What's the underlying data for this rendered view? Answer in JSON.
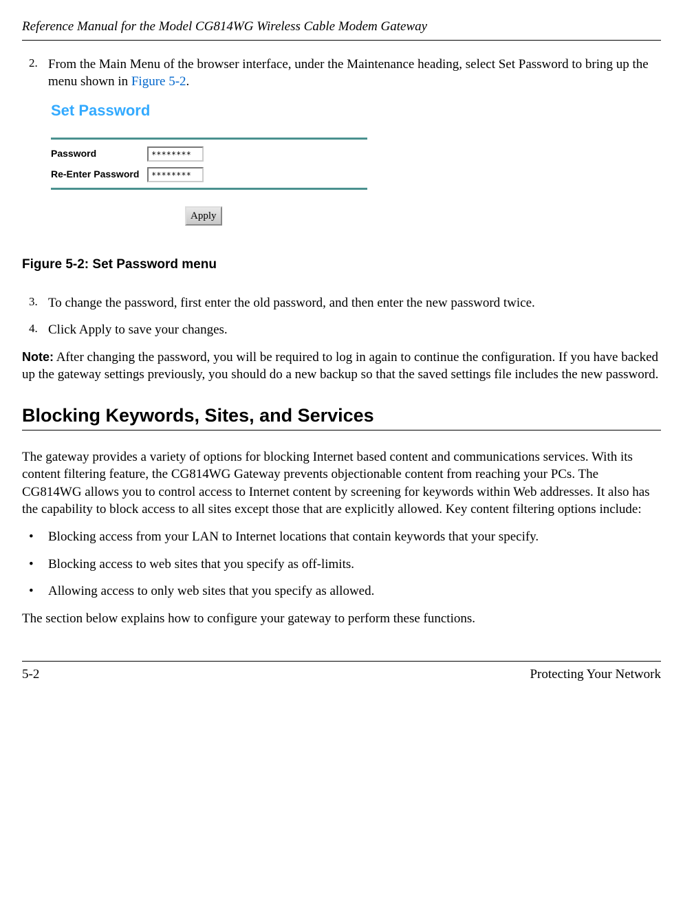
{
  "header": {
    "title": "Reference Manual for the Model CG814WG Wireless Cable Modem Gateway"
  },
  "step2": {
    "num": "2.",
    "text_before": "From the Main Menu of the browser interface, under the Maintenance heading, select Set Password to bring up the menu shown in ",
    "link": "Figure 5-2",
    "text_after": "."
  },
  "figure": {
    "heading": "Set Password",
    "label_password": "Password",
    "label_reenter": "Re-Enter Password",
    "value_password": "********",
    "value_reenter": "********",
    "apply": "Apply",
    "caption": "Figure 5-2: Set Password menu"
  },
  "step3": {
    "num": "3.",
    "text": "To change the password, first enter the old password, and then enter the new password twice."
  },
  "step4": {
    "num": "4.",
    "text": "Click Apply to save your changes."
  },
  "note": {
    "label": "Note:",
    "text": " After changing the password, you will be required to log in again to continue the configuration. If you have backed up the gateway settings previously, you should do a new backup so that the saved settings file includes the new password."
  },
  "section": {
    "heading": "Blocking Keywords, Sites, and Services",
    "intro": "The gateway provides a variety of options for blocking Internet based content and communications services. With its content filtering feature, the CG814WG Gateway prevents objectionable content from reaching your PCs. The CG814WG allows you to control access to Internet content by screening for keywords within Web addresses. It also has the capability to block access to all sites except those that are explicitly allowed. Key content filtering options include:",
    "bullets": [
      "Blocking access from your LAN to Internet locations that contain keywords that your specify.",
      "Blocking access to web sites that you specify as off-limits.",
      "Allowing access to only web sites that you specify as allowed."
    ],
    "outro": "The section below explains how to configure your gateway to perform these functions."
  },
  "footer": {
    "left": "5-2",
    "right": "Protecting Your Network"
  }
}
